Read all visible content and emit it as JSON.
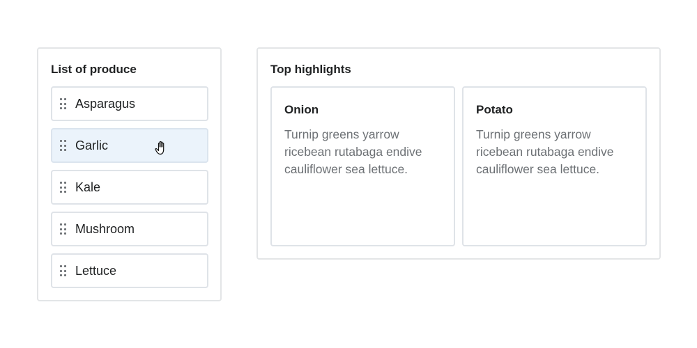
{
  "produce_panel": {
    "title": "List of produce",
    "items": [
      {
        "label": "Asparagus",
        "active": false
      },
      {
        "label": "Garlic",
        "active": true
      },
      {
        "label": "Kale",
        "active": false
      },
      {
        "label": "Mushroom",
        "active": false
      },
      {
        "label": "Lettuce",
        "active": false
      }
    ],
    "drag_handle_icon": "drag-handle-icon",
    "cursor_icon": "grab-hand-cursor-icon"
  },
  "highlights_panel": {
    "title": "Top highlights",
    "cards": [
      {
        "title": "Onion",
        "text": "Turnip greens yarrow ricebean rutabaga endive cauliflower sea lettuce."
      },
      {
        "title": "Potato",
        "text": "Turnip greens yarrow ricebean rutabaga endive cauliflower sea lettuce."
      }
    ]
  },
  "colors": {
    "active_item_background": "#ebf3fb",
    "border": "#e3e5e7",
    "text_primary": "#202223",
    "text_secondary": "#6d7175"
  }
}
